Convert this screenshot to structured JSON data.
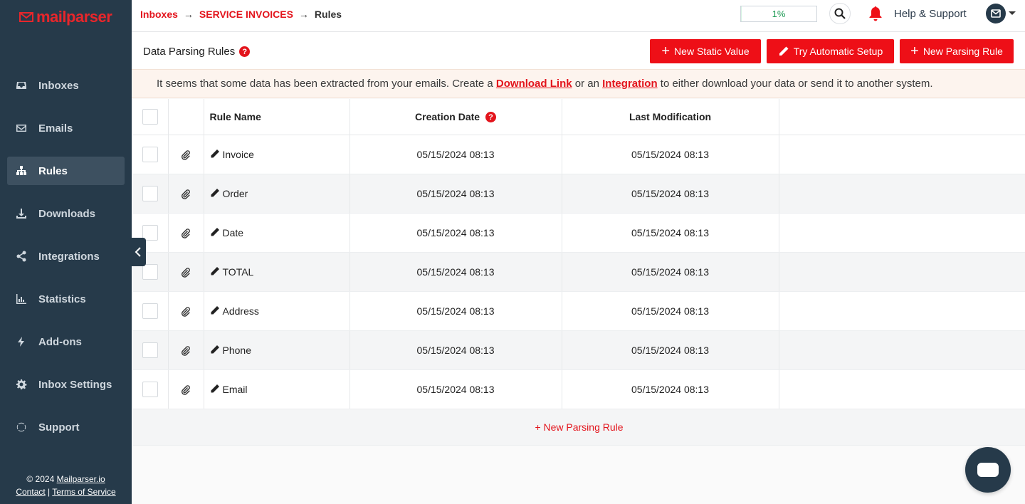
{
  "brand": {
    "name": "mailparser",
    "color": "#e8262b"
  },
  "sidebar": {
    "items": [
      {
        "label": "Inboxes",
        "icon": "inbox-icon",
        "active": false
      },
      {
        "label": "Emails",
        "icon": "envelope-icon",
        "active": false
      },
      {
        "label": "Rules",
        "icon": "sitemap-icon",
        "active": true
      },
      {
        "label": "Downloads",
        "icon": "download-icon",
        "active": false
      },
      {
        "label": "Integrations",
        "icon": "share-icon",
        "active": false
      },
      {
        "label": "Statistics",
        "icon": "chart-icon",
        "active": false
      },
      {
        "label": "Add-ons",
        "icon": "bolt-icon",
        "active": false
      },
      {
        "label": "Inbox Settings",
        "icon": "gear-icon",
        "active": false
      },
      {
        "label": "Support",
        "icon": "lifering-icon",
        "active": false
      }
    ],
    "footer": {
      "copyright": "© 2024",
      "site_link": "Mailparser.io",
      "contact": "Contact",
      "separator": "|",
      "terms": "Terms of Service"
    }
  },
  "breadcrumb": {
    "items": [
      "Inboxes",
      "SERVICE INVOICES"
    ],
    "current": "Rules"
  },
  "topbar": {
    "progress_label": "1%",
    "progress_value": 0.01,
    "help_label": "Help & Support"
  },
  "subheader": {
    "title": "Data Parsing Rules",
    "help_badge": "?",
    "buttons": {
      "static": "New Static Value",
      "auto": "Try Automatic Setup",
      "new_rule": "New Parsing Rule"
    }
  },
  "alert": {
    "text_before": "It seems that some data has been extracted from your emails. Create a ",
    "link1": "Download Link",
    "text_mid": " or an ",
    "link2": "Integration",
    "text_after": " to either download your data or send it to another system."
  },
  "table": {
    "headers": {
      "name": "Rule Name",
      "created": "Creation Date",
      "modified": "Last Modification",
      "help_badge": "?"
    },
    "rows": [
      {
        "name": "Invoice",
        "created": "05/15/2024 08:13",
        "modified": "05/15/2024 08:13"
      },
      {
        "name": "Order",
        "created": "05/15/2024 08:13",
        "modified": "05/15/2024 08:13"
      },
      {
        "name": "Date",
        "created": "05/15/2024 08:13",
        "modified": "05/15/2024 08:13"
      },
      {
        "name": "TOTAL",
        "created": "05/15/2024 08:13",
        "modified": "05/15/2024 08:13"
      },
      {
        "name": "Address",
        "created": "05/15/2024 08:13",
        "modified": "05/15/2024 08:13"
      },
      {
        "name": "Phone",
        "created": "05/15/2024 08:13",
        "modified": "05/15/2024 08:13"
      },
      {
        "name": "Email",
        "created": "05/15/2024 08:13",
        "modified": "05/15/2024 08:13"
      }
    ],
    "footer_action": "+ New Parsing Rule"
  }
}
